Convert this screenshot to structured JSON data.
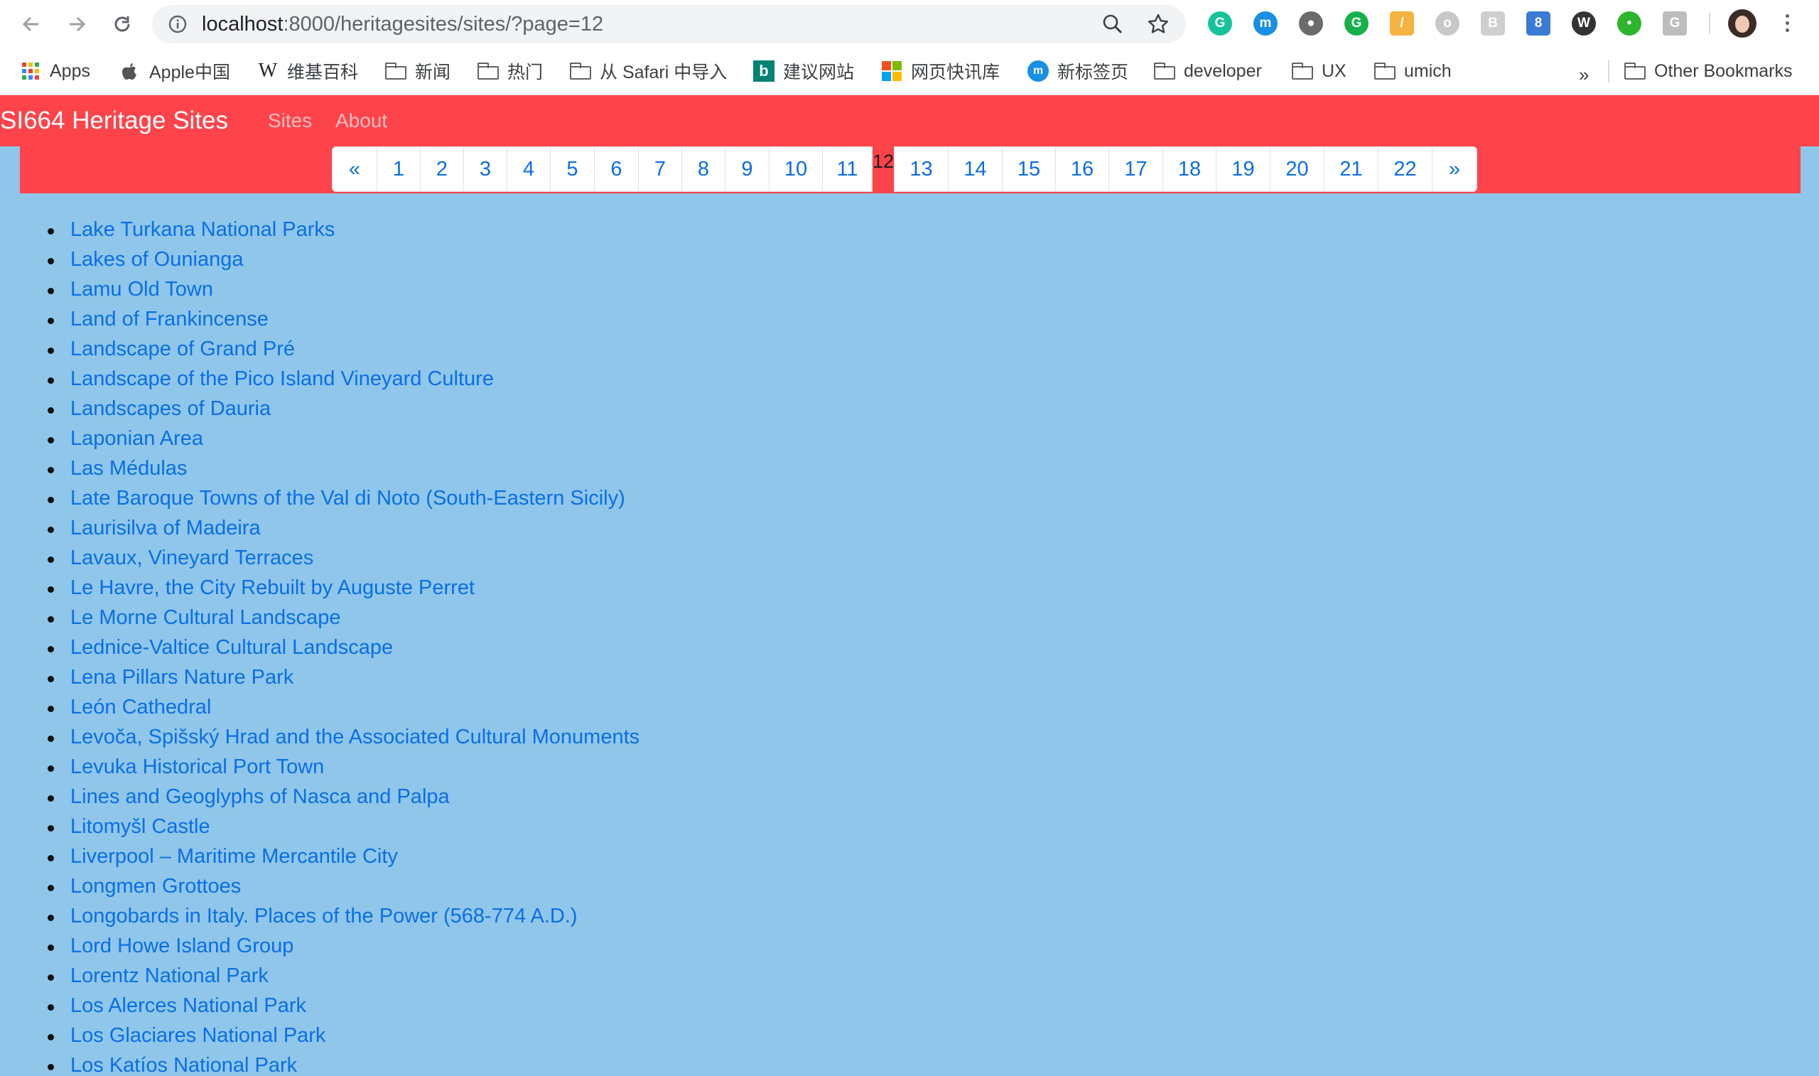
{
  "browser": {
    "url_host": "localhost",
    "url_rest": ":8000/heritagesites/sites/?page=12"
  },
  "bookmarks": [
    {
      "label": "Apps",
      "icon": "apps-grid-icon"
    },
    {
      "label": "Apple中国",
      "icon": "apple-icon"
    },
    {
      "label": "维基百科",
      "icon": "wikipedia-icon"
    },
    {
      "label": "新闻",
      "icon": "folder-icon"
    },
    {
      "label": "热门",
      "icon": "folder-icon"
    },
    {
      "label": "从 Safari 中导入",
      "icon": "folder-icon"
    },
    {
      "label": "建议网站",
      "icon": "bing-icon"
    },
    {
      "label": "网页快讯库",
      "icon": "microsoft-icon"
    },
    {
      "label": "新标签页",
      "icon": "bank-icon"
    },
    {
      "label": "developer",
      "icon": "folder-icon"
    },
    {
      "label": "UX",
      "icon": "folder-icon"
    },
    {
      "label": "umich",
      "icon": "folder-icon"
    }
  ],
  "bookmarks_overflow": "»",
  "other_bookmarks": "Other Bookmarks",
  "navbar": {
    "brand": "SI664 Heritage Sites",
    "links": [
      "Sites",
      "About"
    ]
  },
  "pagination": {
    "prev": "«",
    "next": "»",
    "pages_before": [
      "1",
      "2",
      "3",
      "4",
      "5",
      "6",
      "7",
      "8",
      "9",
      "10",
      "11"
    ],
    "current": "12",
    "pages_after": [
      "13",
      "14",
      "15",
      "16",
      "17",
      "18",
      "19",
      "20",
      "21",
      "22"
    ]
  },
  "sites": [
    "Lake Turkana National Parks",
    "Lakes of Ounianga",
    "Lamu Old Town",
    "Land of Frankincense",
    "Landscape of Grand Pré",
    "Landscape of the Pico Island Vineyard Culture",
    "Landscapes of Dauria",
    "Laponian Area",
    "Las Médulas",
    "Late Baroque Towns of the Val di Noto (South-Eastern Sicily)",
    "Laurisilva of Madeira",
    "Lavaux, Vineyard Terraces",
    "Le Havre, the City Rebuilt by Auguste Perret",
    "Le Morne Cultural Landscape",
    "Lednice-Valtice Cultural Landscape",
    "Lena Pillars Nature Park",
    "León Cathedral",
    "Levoča, Spišský Hrad and the Associated Cultural Monuments",
    "Levuka Historical Port Town",
    "Lines and Geoglyphs of Nasca and Palpa",
    "Litomyšl Castle",
    "Liverpool – Maritime Mercantile City",
    "Longmen Grottoes",
    "Longobards in Italy. Places of the Power (568-774 A.D.)",
    "Lord Howe Island Group",
    "Lorentz National Park",
    "Los Alerces National Park",
    "Los Glaciares National Park",
    "Los Katíos National Park"
  ],
  "colors": {
    "navbar": "#ff434a",
    "page_bg": "#8fc6ea",
    "link": "#0a6ee6"
  }
}
